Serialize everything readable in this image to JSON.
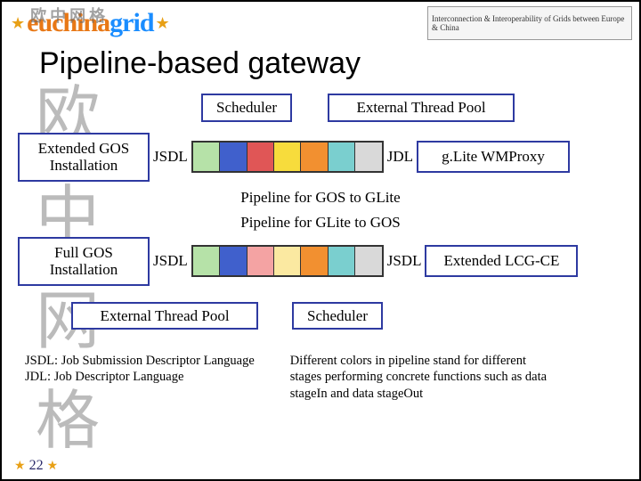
{
  "header": {
    "logo_cn": "欧中网格",
    "logo_eu_left": "euchina",
    "logo_eu_right": "grid",
    "banner_text": "Interconnection & Interoperability of Grids between Europe & China"
  },
  "title": "Pipeline-based gateway",
  "watermark": {
    "c1": "欧",
    "c2": "中",
    "c3": "网",
    "c4": "格"
  },
  "labels": {
    "scheduler": "Scheduler",
    "external_thread_pool": "External Thread Pool",
    "extended_gos": "Extended GOS Installation",
    "full_gos": "Full GOS Installation",
    "jsdl": "JSDL",
    "jdl": "JDL",
    "glite_wmproxy": "g.Lite WMProxy",
    "extended_lcg_ce": "Extended LCG-CE"
  },
  "captions": {
    "gos_to_glite": "Pipeline for GOS to GLite",
    "glite_to_gos": "Pipeline for GLite to GOS"
  },
  "pipelines": {
    "top": [
      "p0",
      "p1",
      "p2",
      "p3",
      "p4",
      "p5",
      "p6"
    ],
    "bottom": [
      "p0",
      "p1",
      "p2b",
      "p3b",
      "p4",
      "p5",
      "p6"
    ]
  },
  "footnotes": {
    "jsdl_def": "JSDL: Job Submission Descriptor Language",
    "jdl_def": "JDL: Job Descriptor Language",
    "color_note": "Different colors in pipeline stand for different stages performing concrete functions such as data stageIn and data stageOut"
  },
  "slide_number": "22"
}
